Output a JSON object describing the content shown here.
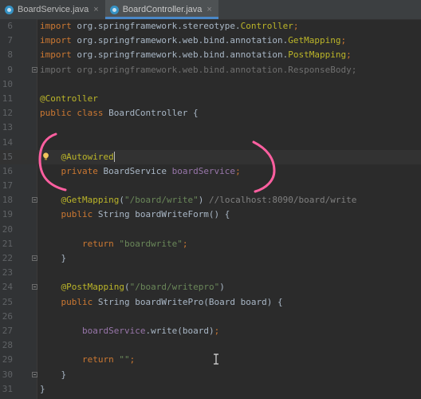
{
  "tabs": [
    {
      "label": "BoardService.java",
      "close": "×",
      "active": false
    },
    {
      "label": "BoardController.java",
      "close": "×",
      "active": true
    }
  ],
  "lines": [
    {
      "n": "6",
      "parts": [
        [
          "kw",
          "import "
        ],
        [
          "t",
          "org.springframework.stereotype."
        ],
        [
          "ann",
          "Controller"
        ],
        [
          "kw",
          ";"
        ]
      ]
    },
    {
      "n": "7",
      "parts": [
        [
          "kw",
          "import "
        ],
        [
          "t",
          "org.springframework.web.bind.annotation."
        ],
        [
          "ann",
          "GetMapping"
        ],
        [
          "kw",
          ";"
        ]
      ]
    },
    {
      "n": "8",
      "parts": [
        [
          "kw",
          "import "
        ],
        [
          "t",
          "org.springframework.web.bind.annotation."
        ],
        [
          "ann",
          "PostMapping"
        ],
        [
          "kw",
          ";"
        ]
      ]
    },
    {
      "n": "9",
      "parts": [
        [
          "grey",
          "import org.springframework.web.bind.annotation.ResponseBody;"
        ]
      ]
    },
    {
      "n": "10",
      "parts": []
    },
    {
      "n": "11",
      "parts": [
        [
          "ann",
          "@Controller"
        ]
      ]
    },
    {
      "n": "12",
      "parts": [
        [
          "kw",
          "public class "
        ],
        [
          "t",
          "BoardController {"
        ]
      ]
    },
    {
      "n": "13",
      "parts": []
    },
    {
      "n": "14",
      "parts": []
    },
    {
      "n": "15",
      "parts": [
        [
          "t",
          "    "
        ],
        [
          "ann",
          "@Autowired"
        ],
        [
          "caret",
          ""
        ]
      ]
    },
    {
      "n": "16",
      "parts": [
        [
          "t",
          "    "
        ],
        [
          "kw",
          "private "
        ],
        [
          "t",
          "BoardService "
        ],
        [
          "fld",
          "boardService"
        ],
        [
          "kw",
          ";"
        ]
      ]
    },
    {
      "n": "17",
      "parts": []
    },
    {
      "n": "18",
      "parts": [
        [
          "t",
          "    "
        ],
        [
          "ann",
          "@GetMapping"
        ],
        [
          "t",
          "("
        ],
        [
          "str",
          "\"/board/write\""
        ],
        [
          "t",
          ") "
        ],
        [
          "cmt",
          "//localhost:8090/board/write"
        ]
      ]
    },
    {
      "n": "19",
      "parts": [
        [
          "t",
          "    "
        ],
        [
          "kw",
          "public "
        ],
        [
          "t",
          "String "
        ],
        [
          "t",
          "boardWriteForm() {"
        ]
      ]
    },
    {
      "n": "20",
      "parts": []
    },
    {
      "n": "21",
      "parts": [
        [
          "t",
          "        "
        ],
        [
          "kw",
          "return "
        ],
        [
          "str",
          "\"boardwrite\""
        ],
        [
          "kw",
          ";"
        ]
      ]
    },
    {
      "n": "22",
      "parts": [
        [
          "t",
          "    }"
        ]
      ]
    },
    {
      "n": "23",
      "parts": []
    },
    {
      "n": "24",
      "parts": [
        [
          "t",
          "    "
        ],
        [
          "ann",
          "@PostMapping"
        ],
        [
          "t",
          "("
        ],
        [
          "str",
          "\"/board/writepro\""
        ],
        [
          "t",
          ")"
        ]
      ]
    },
    {
      "n": "25",
      "parts": [
        [
          "t",
          "    "
        ],
        [
          "kw",
          "public "
        ],
        [
          "t",
          "String "
        ],
        [
          "t",
          "boardWritePro(Board board) {"
        ]
      ]
    },
    {
      "n": "26",
      "parts": []
    },
    {
      "n": "27",
      "parts": [
        [
          "t",
          "        "
        ],
        [
          "fld",
          "boardService"
        ],
        [
          "t",
          ".write(board)"
        ],
        [
          "kw",
          ";"
        ]
      ]
    },
    {
      "n": "28",
      "parts": []
    },
    {
      "n": "29",
      "parts": [
        [
          "t",
          "        "
        ],
        [
          "kw",
          "return "
        ],
        [
          "str",
          "\"\""
        ],
        [
          "kw",
          ";"
        ]
      ]
    },
    {
      "n": "30",
      "parts": [
        [
          "t",
          "    }"
        ]
      ]
    },
    {
      "n": "31",
      "parts": [
        [
          "t",
          "}"
        ]
      ]
    }
  ],
  "colors": {
    "background": "#2b2b2b",
    "keyword": "#cc7832",
    "annotation": "#bbb529",
    "string": "#6a8759",
    "field": "#9876aa",
    "comment": "#808080",
    "text": "#a9b7c6",
    "pen": "#ff5fa0"
  },
  "icons": [
    "java-class-icon",
    "close-icon",
    "fold-icon",
    "intention-bulb-icon",
    "text-cursor-icon"
  ]
}
